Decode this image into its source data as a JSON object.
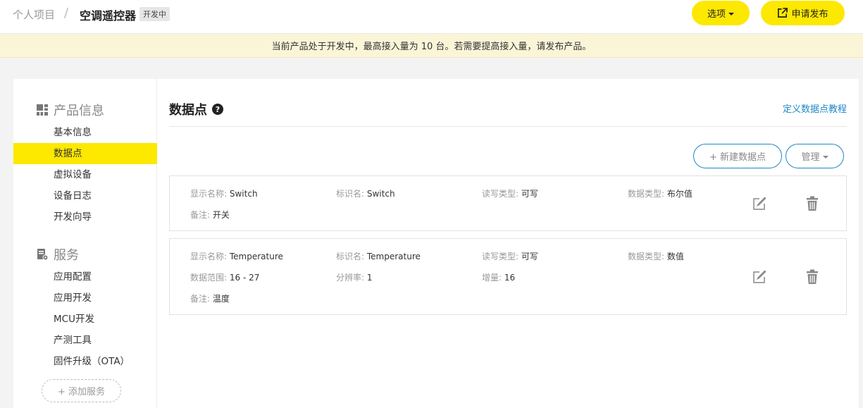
{
  "header": {
    "breadcrumb_root": "个人项目",
    "breadcrumb_sep": "/",
    "product_name": "空调遥控器",
    "status_tag": "开发中",
    "options_label": "选项",
    "publish_label": "申请发布"
  },
  "notice": "当前产品处于开发中，最高接入量为 10 台。若需要提高接入量，请发布产品。",
  "sidebar": {
    "product_section": "产品信息",
    "product_items": [
      {
        "label": "基本信息"
      },
      {
        "label": "数据点"
      },
      {
        "label": "虚拟设备"
      },
      {
        "label": "设备日志"
      },
      {
        "label": "开发向导"
      }
    ],
    "service_section": "服务",
    "service_items": [
      {
        "label": "应用配置"
      },
      {
        "label": "应用开发"
      },
      {
        "label": "MCU开发"
      },
      {
        "label": "产测工具"
      },
      {
        "label": "固件升级（OTA）"
      }
    ],
    "add_service": "+ 添加服务",
    "active_item": "数据点"
  },
  "main": {
    "title": "数据点",
    "help_glyph": "?",
    "tutorial_link": "定义数据点教程",
    "new_datapoint": "+ 新建数据点",
    "manage": "管理"
  },
  "datapoints": [
    {
      "display_label": "显示名称:",
      "display_name": "Switch",
      "id_label": "标识名:",
      "id_name": "Switch",
      "rw_label": "读写类型:",
      "rw_type": "可写",
      "type_label": "数据类型:",
      "data_type": "布尔值",
      "note_label": "备注:",
      "note": "开关"
    },
    {
      "display_label": "显示名称:",
      "display_name": "Temperature",
      "id_label": "标识名:",
      "id_name": "Temperature",
      "rw_label": "读写类型:",
      "rw_type": "可写",
      "type_label": "数据类型:",
      "data_type": "数值",
      "range_label": "数据范围:",
      "range": "16 - 27",
      "res_label": "分辨率:",
      "resolution": "1",
      "inc_label": "增量:",
      "increment": "16",
      "note_label": "备注:",
      "note": "温度"
    }
  ],
  "colors": {
    "accent_yellow": "#fde800",
    "link_blue": "#1e88c7",
    "notice_bg": "#fbf5d8"
  },
  "icons": [
    "grid-icon",
    "service-icon",
    "external-link-icon",
    "help-icon",
    "edit-icon",
    "trash-icon"
  ]
}
